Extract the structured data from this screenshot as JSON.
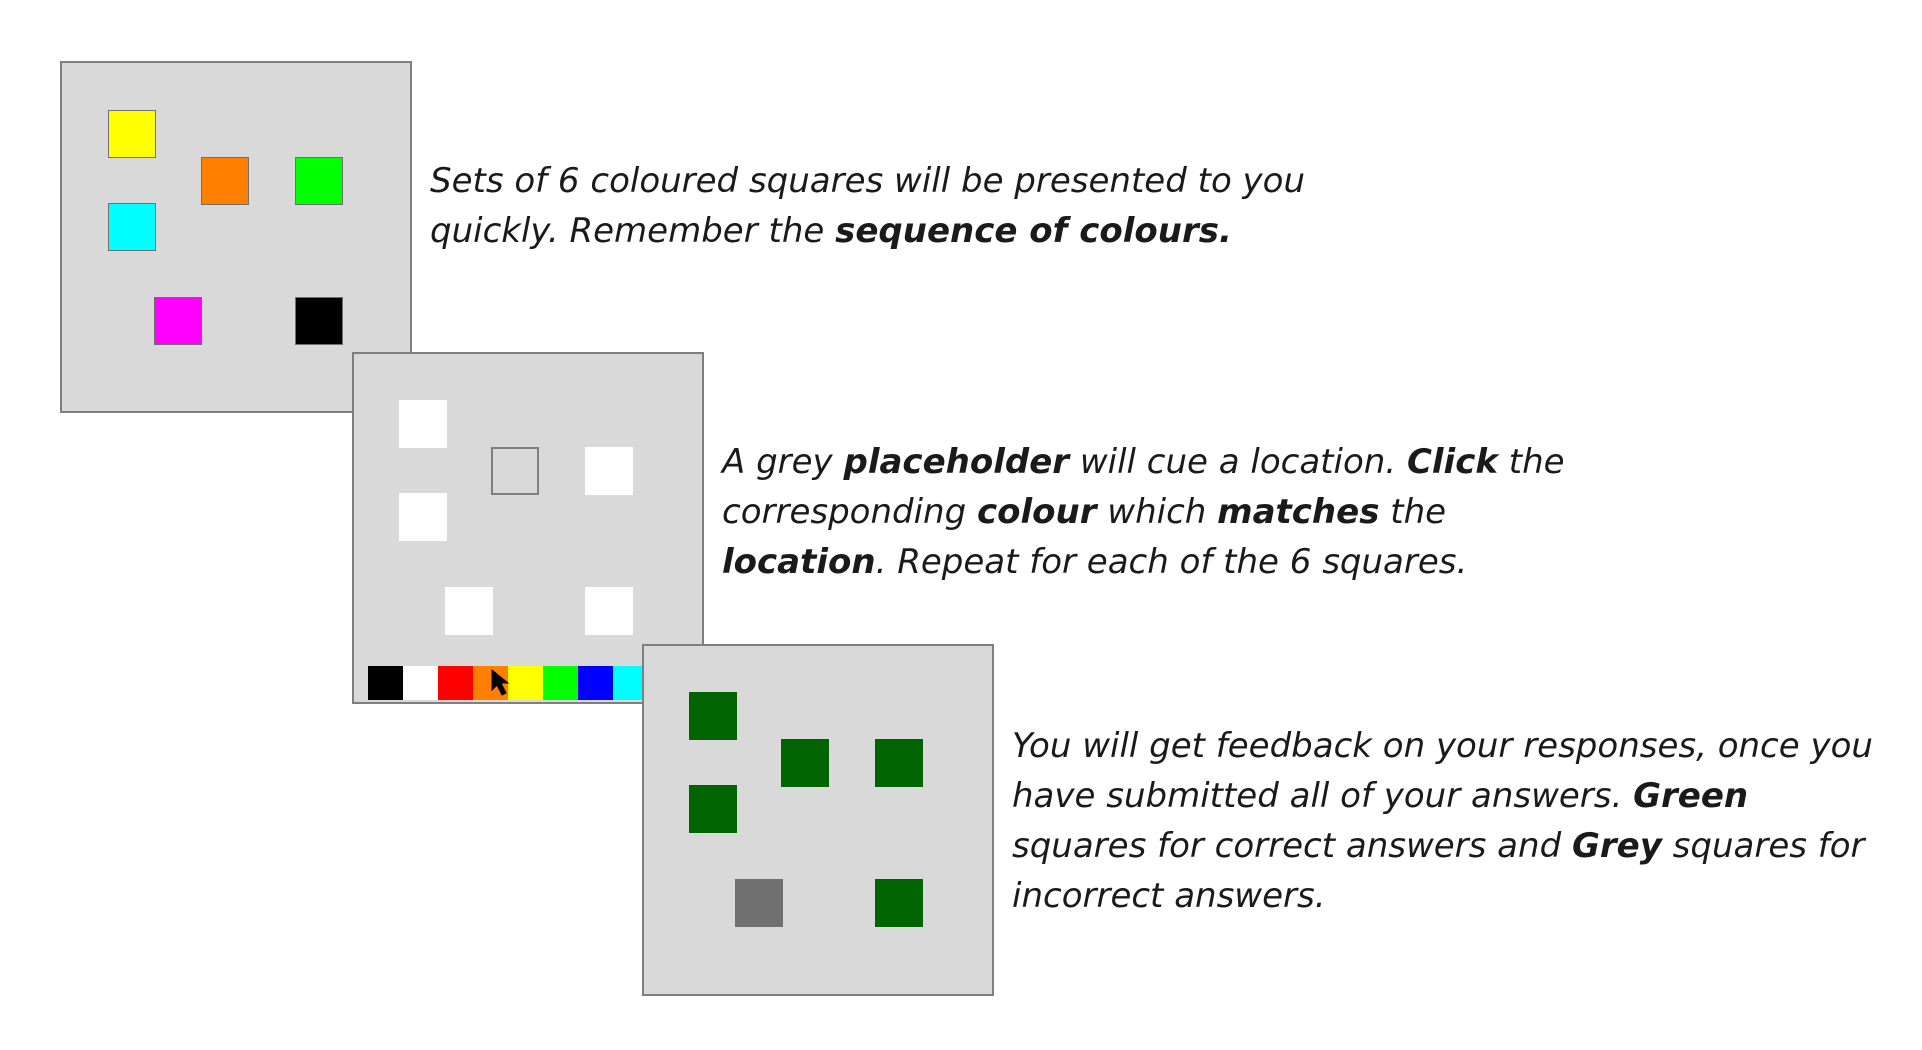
{
  "colors": {
    "panel": "#d9d9d9",
    "yellow": "#ffff00",
    "orange": "#ff7f00",
    "green": "#00ff00",
    "cyan": "#00ffff",
    "magenta": "#ff00ff",
    "black": "#000000",
    "white": "#ffffff",
    "red": "#ff0000",
    "blue": "#0000ff",
    "feedback_correct": "#006400",
    "feedback_incorrect": "#707070"
  },
  "panels": [
    {
      "name": "presentation-panel",
      "squares": [
        "yellow",
        "orange",
        "green",
        "cyan",
        "magenta",
        "black"
      ]
    },
    {
      "name": "response-panel",
      "squares": [
        "white",
        "placeholder",
        "white",
        "white",
        "white",
        "white"
      ],
      "palette": [
        "black",
        "white",
        "red",
        "orange",
        "yellow",
        "green",
        "blue",
        "cyan"
      ]
    },
    {
      "name": "feedback-panel",
      "squares": [
        "correct",
        "correct",
        "correct",
        "correct",
        "incorrect",
        "correct"
      ]
    }
  ],
  "captions": {
    "step1": {
      "a": "Sets of 6 coloured squares will be presented to you quickly. Remember the ",
      "b": "sequence of colours."
    },
    "step2": {
      "a": "A grey ",
      "b": "placeholder",
      "c": " will cue a location. ",
      "d": "Click",
      "e": " the corresponding ",
      "f": "colour",
      "g": " which ",
      "h": "matches",
      "i": " the ",
      "j": "location",
      "k": ". Repeat for each of the 6 squares."
    },
    "step3": {
      "a": "You will get feedback on your responses, once you have submitted all of your answers. ",
      "b": "Green",
      "c": " squares for correct answers and ",
      "d": "Grey",
      "e": " squares for incorrect answers."
    }
  }
}
